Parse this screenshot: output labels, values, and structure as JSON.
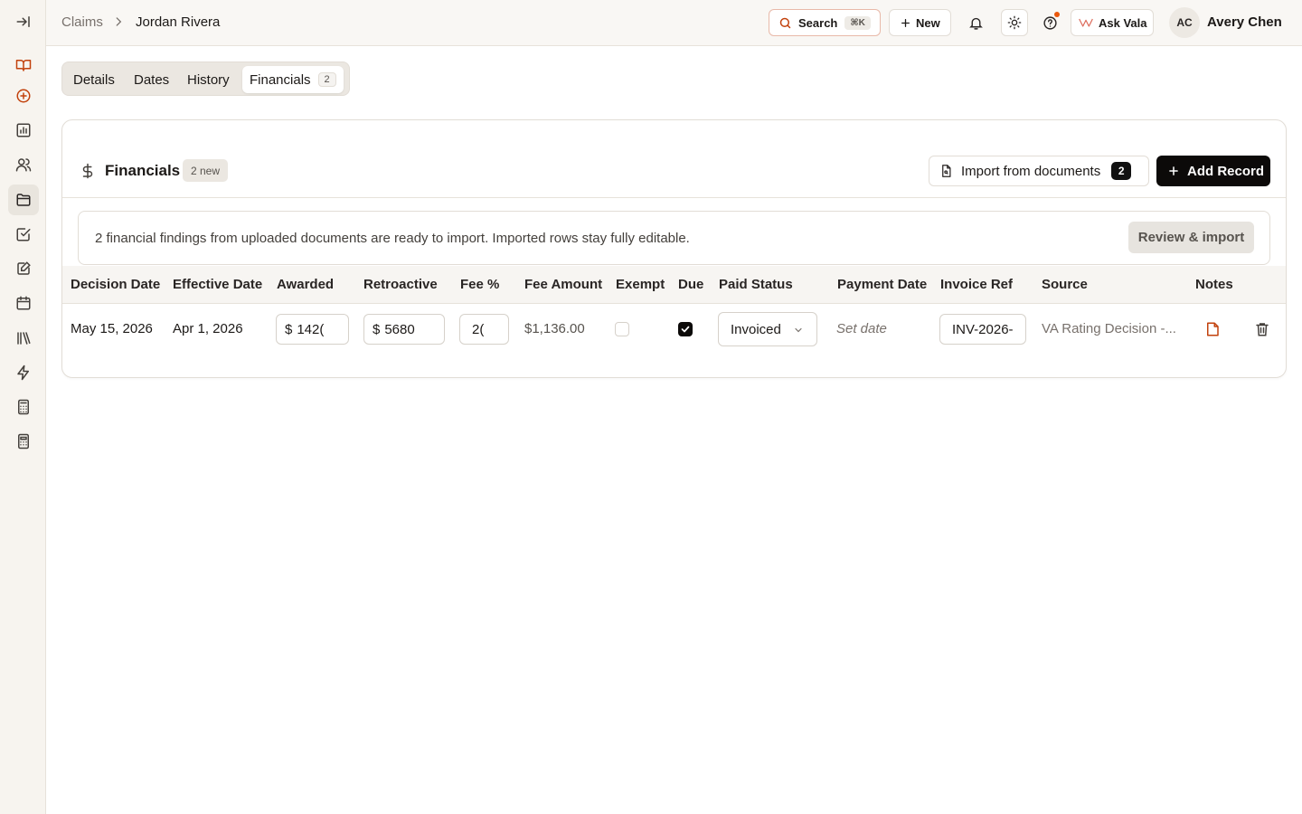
{
  "breadcrumb": {
    "parent": "Claims",
    "current": "Jordan Rivera"
  },
  "topbar": {
    "search_label": "Search",
    "search_shortcut": "⌘K",
    "new_label": "New",
    "ask_label": "Ask Vala",
    "user_initials": "AC",
    "user_name": "Avery Chen"
  },
  "sidebar": {
    "items": [
      "collapse-sidebar",
      "book",
      "add-circle",
      "chart",
      "users",
      "folder",
      "checklist",
      "edit-note",
      "calendar",
      "library",
      "bolt",
      "calculator",
      "calculator-alt"
    ],
    "active": "folder"
  },
  "tabs": [
    {
      "label": "Details"
    },
    {
      "label": "Dates"
    },
    {
      "label": "History"
    },
    {
      "label": "Financials",
      "count": "2",
      "active": true
    }
  ],
  "financials": {
    "title": "Financials",
    "new_badge": "2 new",
    "import_label": "Import from documents",
    "import_count": "2",
    "add_label": "Add Record",
    "banner_text": "2 financial findings from uploaded documents are ready to import. Imported rows stay fully editable.",
    "review_label": "Review & import",
    "columns": [
      "Decision Date",
      "Effective Date",
      "Awarded",
      "Retroactive",
      "Fee %",
      "Fee Amount",
      "Exempt",
      "Due",
      "Paid Status",
      "Payment Date",
      "Invoice Ref",
      "Source",
      "Notes"
    ],
    "rows": [
      {
        "decision_date": "May 15, 2026",
        "effective_date": "Apr 1, 2026",
        "awarded_currency": "$",
        "awarded": "142(",
        "retro_currency": "$",
        "retroactive": "5680",
        "fee_pct": "2(",
        "fee_amount": "$1,136.00",
        "exempt": false,
        "due": true,
        "paid_status": "Invoiced",
        "payment_date": "Set date",
        "invoice_ref": "INV-2026-",
        "source": "VA Rating Decision -..."
      }
    ]
  },
  "colors": {
    "accent": "#c2410c",
    "dark": "#0c0a09",
    "panel": "#f7f4ef"
  }
}
